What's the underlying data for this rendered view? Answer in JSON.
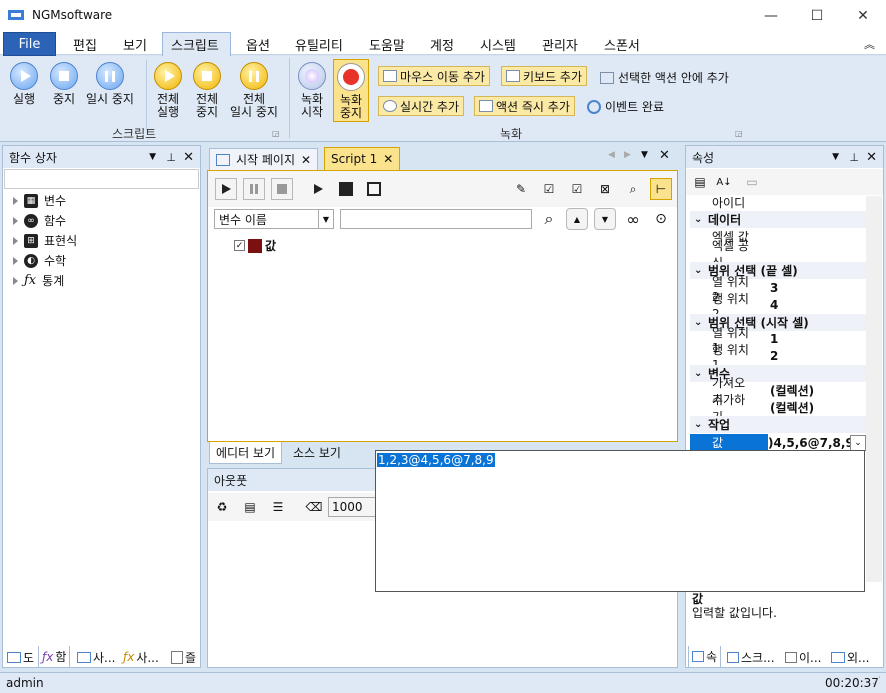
{
  "window": {
    "title": "NGMsoftware",
    "minimize": "—",
    "maximize": "☐",
    "close": "✕"
  },
  "menu": {
    "file": "File",
    "items": [
      "편집",
      "보기",
      "스크립트",
      "옵션",
      "유틸리티",
      "도움말",
      "계정",
      "시스템",
      "관리자",
      "스폰서"
    ],
    "active": "스크립트",
    "collapse": "︽"
  },
  "ribbon": {
    "script_group": {
      "label": "스크립트",
      "run": "실행",
      "stop": "중지",
      "pause": "일시 중지",
      "all_run_1": "전체",
      "all_run_2": "실행",
      "all_stop_1": "전체",
      "all_stop_2": "중지",
      "all_pause_1": "전체",
      "all_pause_2": "일시 중지"
    },
    "record_group": {
      "label": "녹화",
      "rec_start_1": "녹화",
      "rec_start_2": "시작",
      "rec_stop_1": "녹화",
      "rec_stop_2": "중지",
      "add_mouse": "마우스 이동 추가",
      "add_keyboard": "키보드 추가",
      "add_in_selected": "선택한 액션 안에 추가",
      "add_realtime": "실시간 추가",
      "add_action_now": "액션 즉시 추가",
      "event_done": "이벤트 완료"
    }
  },
  "left_panel": {
    "title": "함수 상자",
    "items": [
      {
        "icon": "variable-icon",
        "label": "변수"
      },
      {
        "icon": "function-icon",
        "label": "함수"
      },
      {
        "icon": "expression-icon",
        "label": "표현식"
      },
      {
        "icon": "math-icon",
        "label": "수학"
      },
      {
        "icon": "statistics-icon",
        "label": "통계"
      }
    ],
    "bottom_tabs": [
      "도",
      "함",
      "사...",
      "사...",
      "즐"
    ]
  },
  "editor": {
    "tabs": [
      {
        "label": "시작 페이지"
      },
      {
        "label": "Script 1"
      }
    ],
    "variable_select": "변수 이름",
    "item_label": "값",
    "view_tabs": [
      "에디터 보기",
      "소스 보기"
    ]
  },
  "output": {
    "title": "아웃풋",
    "delay_value": "1000"
  },
  "properties": {
    "title": "속성",
    "rows": [
      {
        "type": "prop",
        "name": "아이디",
        "value": ""
      },
      {
        "type": "cat",
        "name": "데이터"
      },
      {
        "type": "prop",
        "name": "엑셀 값",
        "value": ""
      },
      {
        "type": "prop",
        "name": "엑셀 공식",
        "value": ""
      },
      {
        "type": "cat",
        "name": "범위 선택 (끝 셀)"
      },
      {
        "type": "prop",
        "name": "열 위치 2",
        "value": "3"
      },
      {
        "type": "prop",
        "name": "행 위치 2",
        "value": "4"
      },
      {
        "type": "cat",
        "name": "범위 선택 (시작 셀)"
      },
      {
        "type": "prop",
        "name": "열 위치 1",
        "value": "1"
      },
      {
        "type": "prop",
        "name": "행 위치 1",
        "value": "2"
      },
      {
        "type": "cat",
        "name": "변수"
      },
      {
        "type": "prop",
        "name": "가져오기",
        "value": "(컬렉션)"
      },
      {
        "type": "prop",
        "name": "추가하기",
        "value": "(컬렉션)"
      },
      {
        "type": "cat",
        "name": "작업"
      }
    ],
    "selected_name": "값",
    "selected_value": ")4,5,6@7,8,9",
    "desc_title": "값",
    "desc_text": "입력할 값입니다.",
    "bottom_tabs": [
      "속",
      "스크...",
      "이...",
      "외..."
    ]
  },
  "dropdown": {
    "value": "1,2,3@4,5,6@7,8,9"
  },
  "status": {
    "user": "admin",
    "time": "00:20:37"
  }
}
